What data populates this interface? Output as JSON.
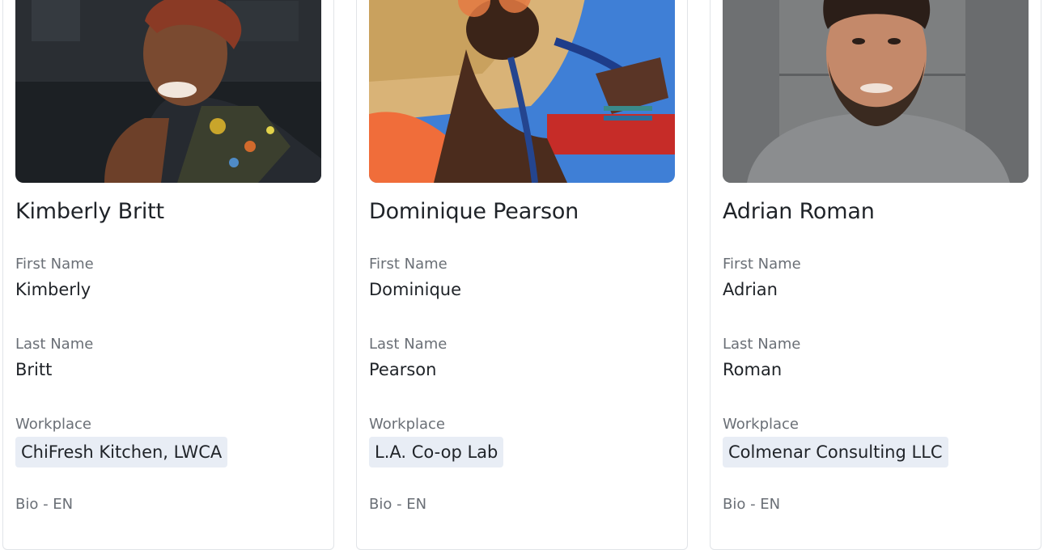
{
  "cards": [
    {
      "full_name": "Kimberly Britt",
      "first_name_label": "First Name",
      "first_name": "Kimberly",
      "last_name_label": "Last Name",
      "last_name": "Britt",
      "workplace_label": "Workplace",
      "workplace": "ChiFresh Kitchen, LWCA",
      "bio_label": "Bio - EN"
    },
    {
      "full_name": "Dominique Pearson",
      "first_name_label": "First Name",
      "first_name": "Dominique",
      "last_name_label": "Last Name",
      "last_name": "Pearson",
      "workplace_label": "Workplace",
      "workplace": "L.A. Co-op Lab",
      "bio_label": "Bio - EN"
    },
    {
      "full_name": "Adrian Roman",
      "first_name_label": "First Name",
      "first_name": "Adrian",
      "last_name_label": "Last Name",
      "last_name": "Roman",
      "workplace_label": "Workplace",
      "workplace": "Colmenar Consulting LLC",
      "bio_label": "Bio - EN"
    }
  ],
  "colors": {
    "tag_bg": "#e8edf5",
    "label": "#6a6f76",
    "text": "#1f2328",
    "card_border": "#e1e4e8"
  }
}
